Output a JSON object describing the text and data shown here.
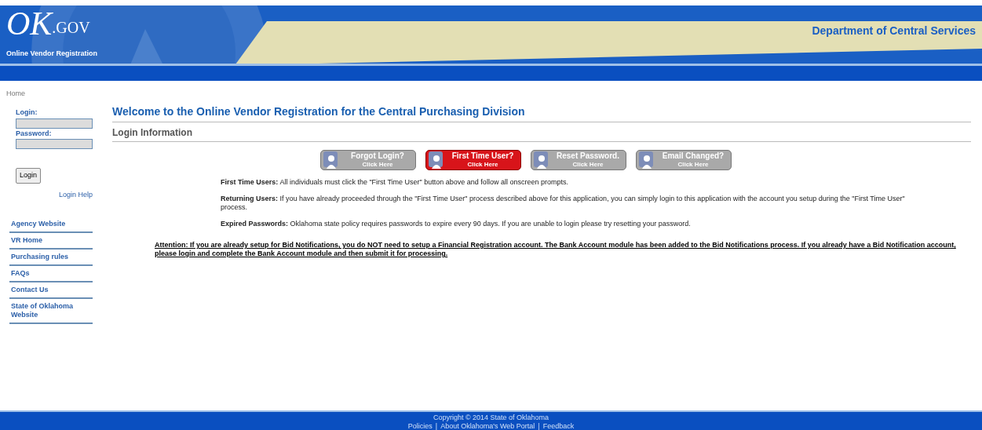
{
  "header": {
    "logo_mark": "OK",
    "logo_suffix": ".GOV",
    "subtitle": "Online Vendor Registration",
    "agency": "Department of Central Services"
  },
  "breadcrumb": "Home",
  "login": {
    "login_label": "Login:",
    "password_label": "Password:",
    "button": "Login",
    "help": "Login Help"
  },
  "sidebar": {
    "items": [
      "Agency Website",
      "VR Home",
      "Purchasing rules",
      "FAQs",
      "Contact Us",
      "State of Oklahoma Website"
    ]
  },
  "main": {
    "title": "Welcome to the Online Vendor Registration for the Central Purchasing Division",
    "section": "Login Information",
    "buttons": [
      {
        "label": "Forgot Login?",
        "sub": "Click Here",
        "selected": false
      },
      {
        "label": "First Time User?",
        "sub": "Click Here",
        "selected": true
      },
      {
        "label": "Reset Password.",
        "sub": "Click Here",
        "selected": false
      },
      {
        "label": "Email Changed?",
        "sub": "Click Here",
        "selected": false
      }
    ],
    "paragraphs": [
      "**First Time Users:** All individuals must click the \"First Time User\" button above and follow all onscreen prompts.",
      "**Returning Users:** If you have already proceeded through the \"First Time User\" process described above for this application, you can simply login to this application with the account you setup during the \"First Time User\" process.",
      "**Expired Passwords:** Oklahoma state policy requires passwords to expire every 90 days. If you are unable to login please try resetting your password."
    ],
    "attention": "Attention: If you are already setup for Bid Notifications, you do NOT need to setup a Financial Registration account. The Bank Account module has been added to the Bid Notifications process. If you already have a Bid Notification account, please login and complete the Bank Account module and then submit it for processing."
  },
  "footer": {
    "copyright": "Copyright © 2014 State of Oklahoma",
    "separator": "|",
    "links": [
      "Policies",
      "About Oklahoma's Web Portal",
      "Feedback"
    ]
  }
}
